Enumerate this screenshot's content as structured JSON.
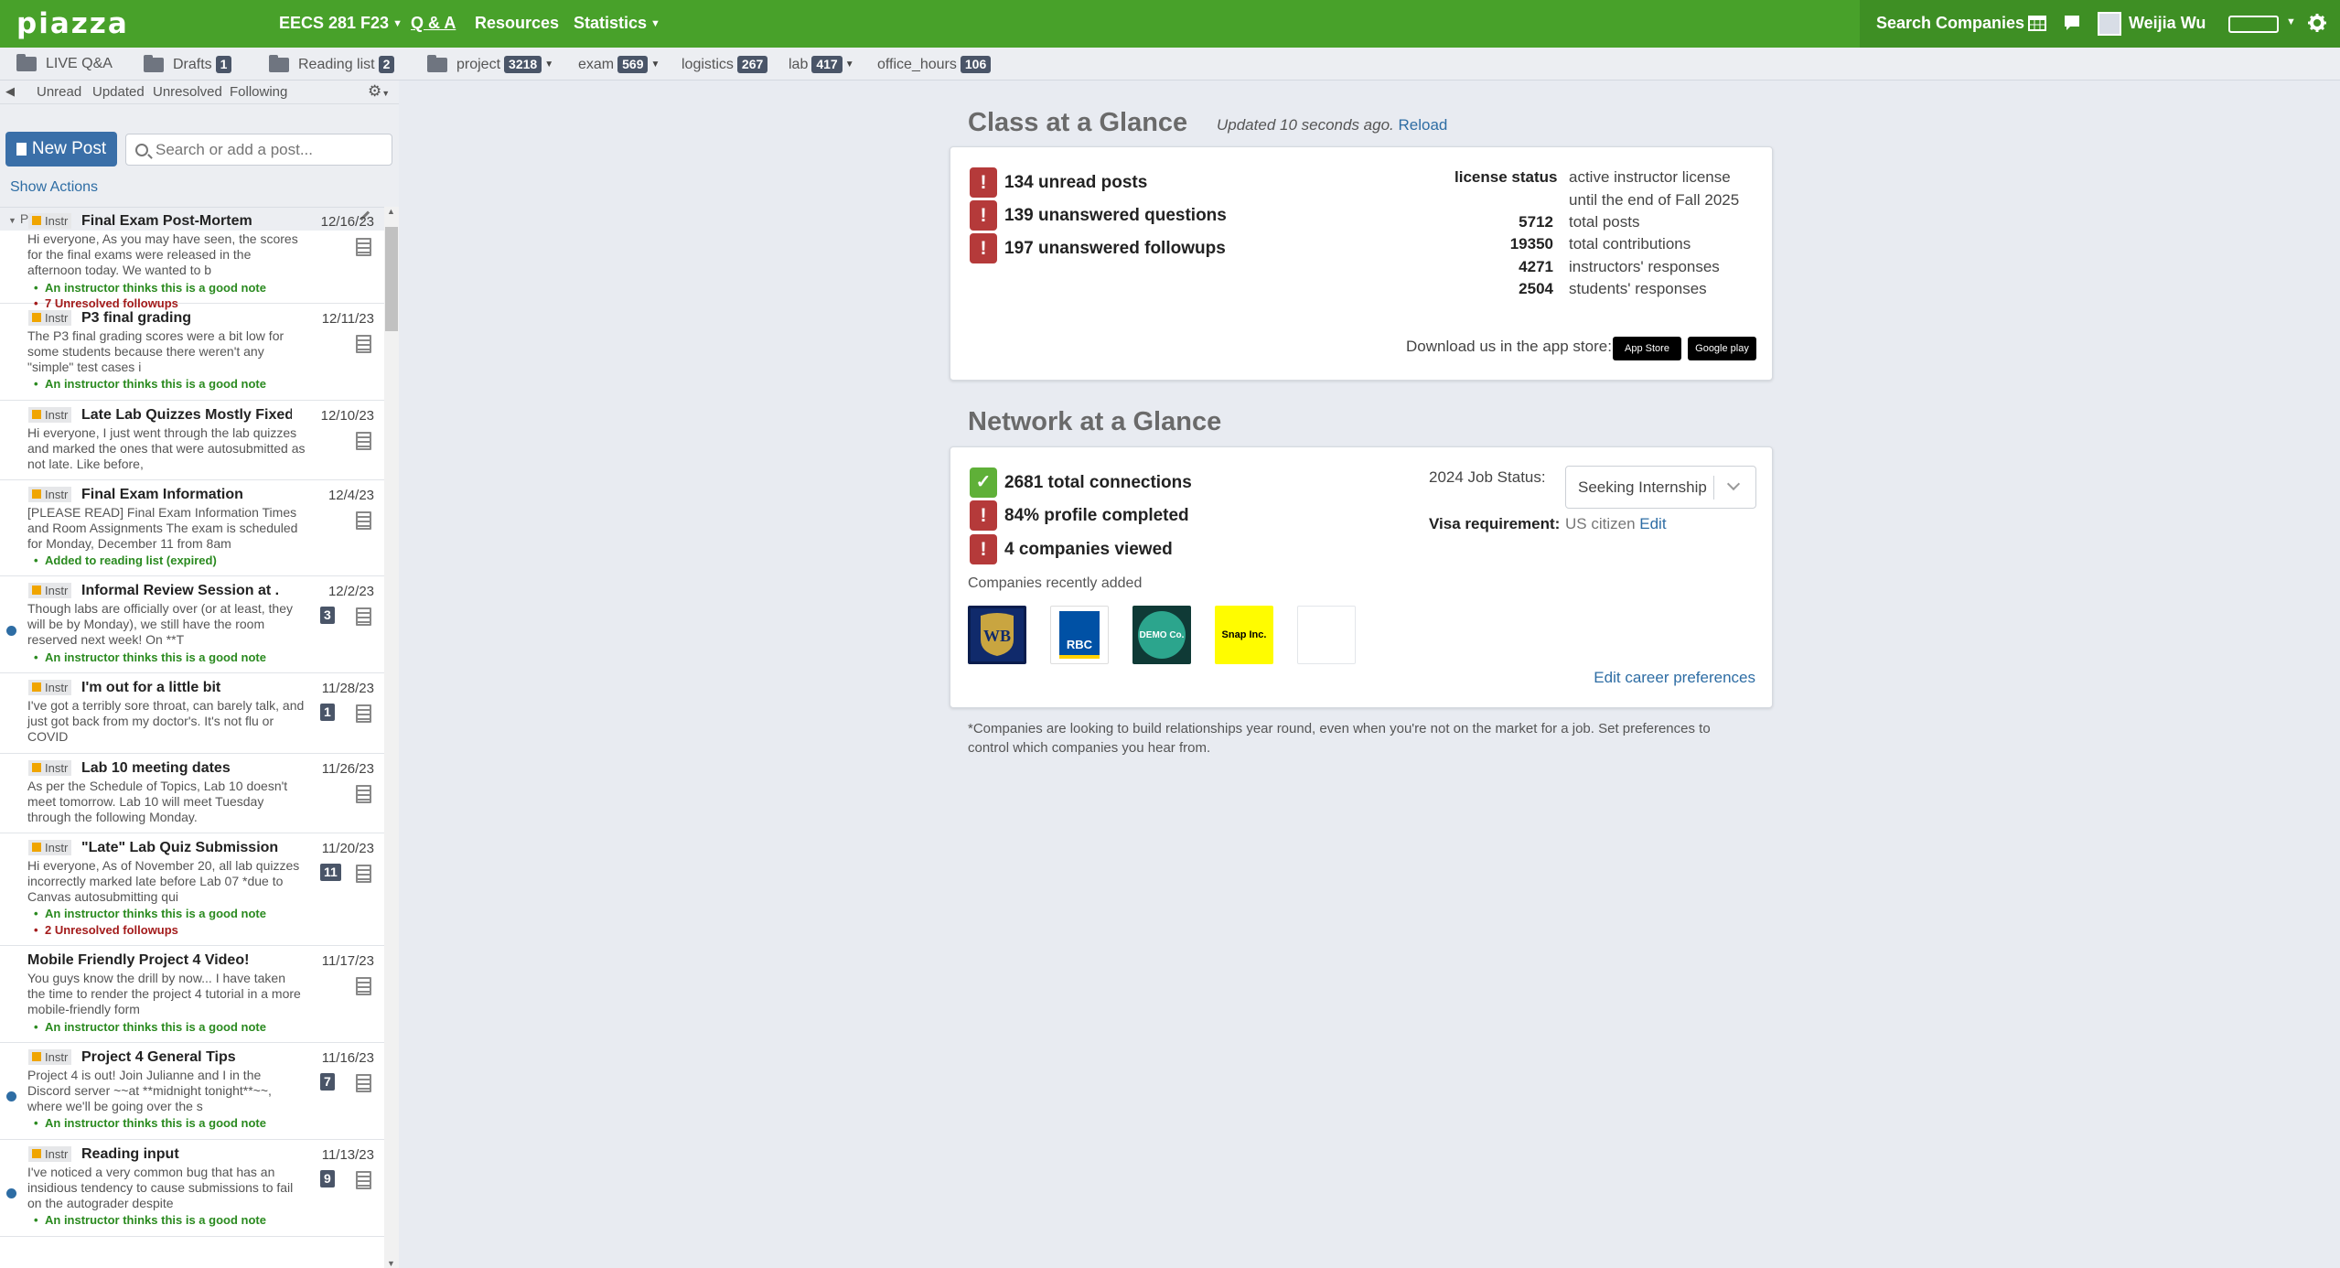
{
  "topbar": {
    "logo": "piazza",
    "course": "EECS 281 F23",
    "nav": {
      "qa": "Q & A",
      "resources": "Resources",
      "statistics": "Statistics"
    },
    "search_companies": "Search Companies",
    "user_name": "Weijia Wu"
  },
  "folders": {
    "live_qa": "LIVE Q&A",
    "drafts": "Drafts",
    "drafts_count": "1",
    "reading_list": "Reading list",
    "reading_count": "2",
    "project": "project",
    "project_count": "3218",
    "exam": "exam",
    "exam_count": "569",
    "logistics": "logistics",
    "logistics_count": "267",
    "lab": "lab",
    "lab_count": "417",
    "office_hours": "office_hours",
    "office_hours_count": "106"
  },
  "filters": {
    "unread": "Unread",
    "updated": "Updated",
    "unresolved": "Unresolved",
    "following": "Following"
  },
  "toolbar": {
    "new_post": "New Post",
    "search_placeholder": "Search or add a post...",
    "show_actions": "Show Actions",
    "pinned": "PINNED"
  },
  "posts": [
    {
      "tag": "Instr",
      "title": "Final Exam Post-Mortem",
      "date": "12/16/23",
      "body": "Hi everyone,   As you may have seen, the scores for the final exams were released in the afternoon today. We wanted to b",
      "note1": "An instructor thinks this is a good note",
      "note2": "7 Unresolved followups"
    },
    {
      "tag": "Instr",
      "title": "P3 final grading",
      "date": "12/11/23",
      "body": "The P3 final grading scores were a bit low for some students because there weren't any \"simple\" test cases i",
      "note1": "An instructor thinks this is a good note"
    },
    {
      "tag": "Instr",
      "title": "Late Lab Quizzes Mostly Fixed",
      "date": "12/10/23",
      "body": "Hi everyone, I just went through the lab quizzes and marked the ones that were autosubmitted as not late. Like before,"
    },
    {
      "tag": "Instr",
      "title": "Final Exam Information",
      "date": "12/4/23",
      "body": "[PLEASE READ] Final Exam Information Times and Room Assignments The exam is scheduled for Monday, December 11 from 8am",
      "note1": "Added to reading list (expired)"
    },
    {
      "tag": "Instr",
      "title": "Informal Review Session at ...",
      "date": "12/2/23",
      "count": "3",
      "body": "Though labs are officially over (or at least, they will be by Monday), we still have the room reserved next week! On **T",
      "note1": "An instructor thinks this is a good note"
    },
    {
      "tag": "Instr",
      "title": "I'm out for a little bit",
      "date": "11/28/23",
      "count": "1",
      "body": "I've got a terribly sore throat, can barely talk, and just got back from my doctor's.  It's not flu or COVID"
    },
    {
      "tag": "Instr",
      "title": "Lab 10 meeting dates",
      "date": "11/26/23",
      "body": "As per the Schedule of Topics, Lab 10 doesn't meet tomorrow.  Lab 10 will meet Tuesday through the following Monday."
    },
    {
      "tag": "Instr",
      "title": "\"Late\" Lab Quiz Submission...",
      "date": "11/20/23",
      "count": "11",
      "body": "Hi everyone, As of November 20, all lab quizzes incorrectly marked late before Lab 07 *due to Canvas autosubmitting qui",
      "note1": "An instructor thinks this is a good note",
      "note2": "2 Unresolved followups"
    },
    {
      "tag": "",
      "title": "Mobile Friendly Project 4 Video!",
      "date": "11/17/23",
      "body": "You guys know the drill by now... I have taken the time to render the project 4 tutorial in a more mobile-friendly form",
      "note1": "An instructor thinks this is a good note"
    },
    {
      "tag": "Instr",
      "title": "Project 4 General Tips",
      "date": "11/16/23",
      "count": "7",
      "body": "Project 4 is out! Join Julianne and I in the Discord server ~~at **midnight tonight**~~, where we'll be going over the s",
      "note1": "An instructor thinks this is a good note"
    },
    {
      "tag": "Instr",
      "title": "Reading input",
      "date": "11/13/23",
      "count": "9",
      "body": "I've noticed a very common bug that has an insidious tendency to cause submissions to fail on the autograder despite",
      "note1": "An instructor thinks this is a good note"
    }
  ],
  "class_glance": {
    "heading": "Class at a Glance",
    "updated": "Updated 10 seconds ago.",
    "reload": "Reload",
    "stats": [
      "134 unread posts",
      "139 unanswered questions",
      "197 unanswered followups"
    ],
    "license_label": "license status",
    "license_line1": "active instructor license",
    "license_line2": "until the end of Fall 2025",
    "counts": [
      {
        "num": "5712",
        "label": "total posts"
      },
      {
        "num": "19350",
        "label": "total contributions"
      },
      {
        "num": "4271",
        "label": "instructors' responses"
      },
      {
        "num": "2504",
        "label": "students' responses"
      }
    ],
    "download_text": "Download us in the app store:",
    "app_store": "App Store",
    "google_play": "Google play"
  },
  "network_glance": {
    "heading": "Network at a Glance",
    "stats": [
      "2681 total connections",
      "84% profile completed",
      "4 companies viewed"
    ],
    "job_status_label": "2024 Job Status:",
    "job_status_value": "Seeking Internship",
    "visa_label": "Visa requirement:",
    "visa_value": "US citizen",
    "visa_edit": "Edit",
    "recent_label": "Companies recently added",
    "companies": [
      "WB",
      "RBC",
      "DEMO Co.",
      "Snap Inc."
    ],
    "edit_career": "Edit career preferences",
    "footnote": "*Companies are looking to build relationships year round, even when you're not on the market for a job. Set preferences to control which companies you hear from."
  },
  "colors": {
    "brand_green": "#48a12a",
    "link_blue": "#2e6da4",
    "warn_red": "#b53a3a",
    "good_note_green": "#2a8a1f",
    "unresolved_red": "#a31b1b"
  }
}
